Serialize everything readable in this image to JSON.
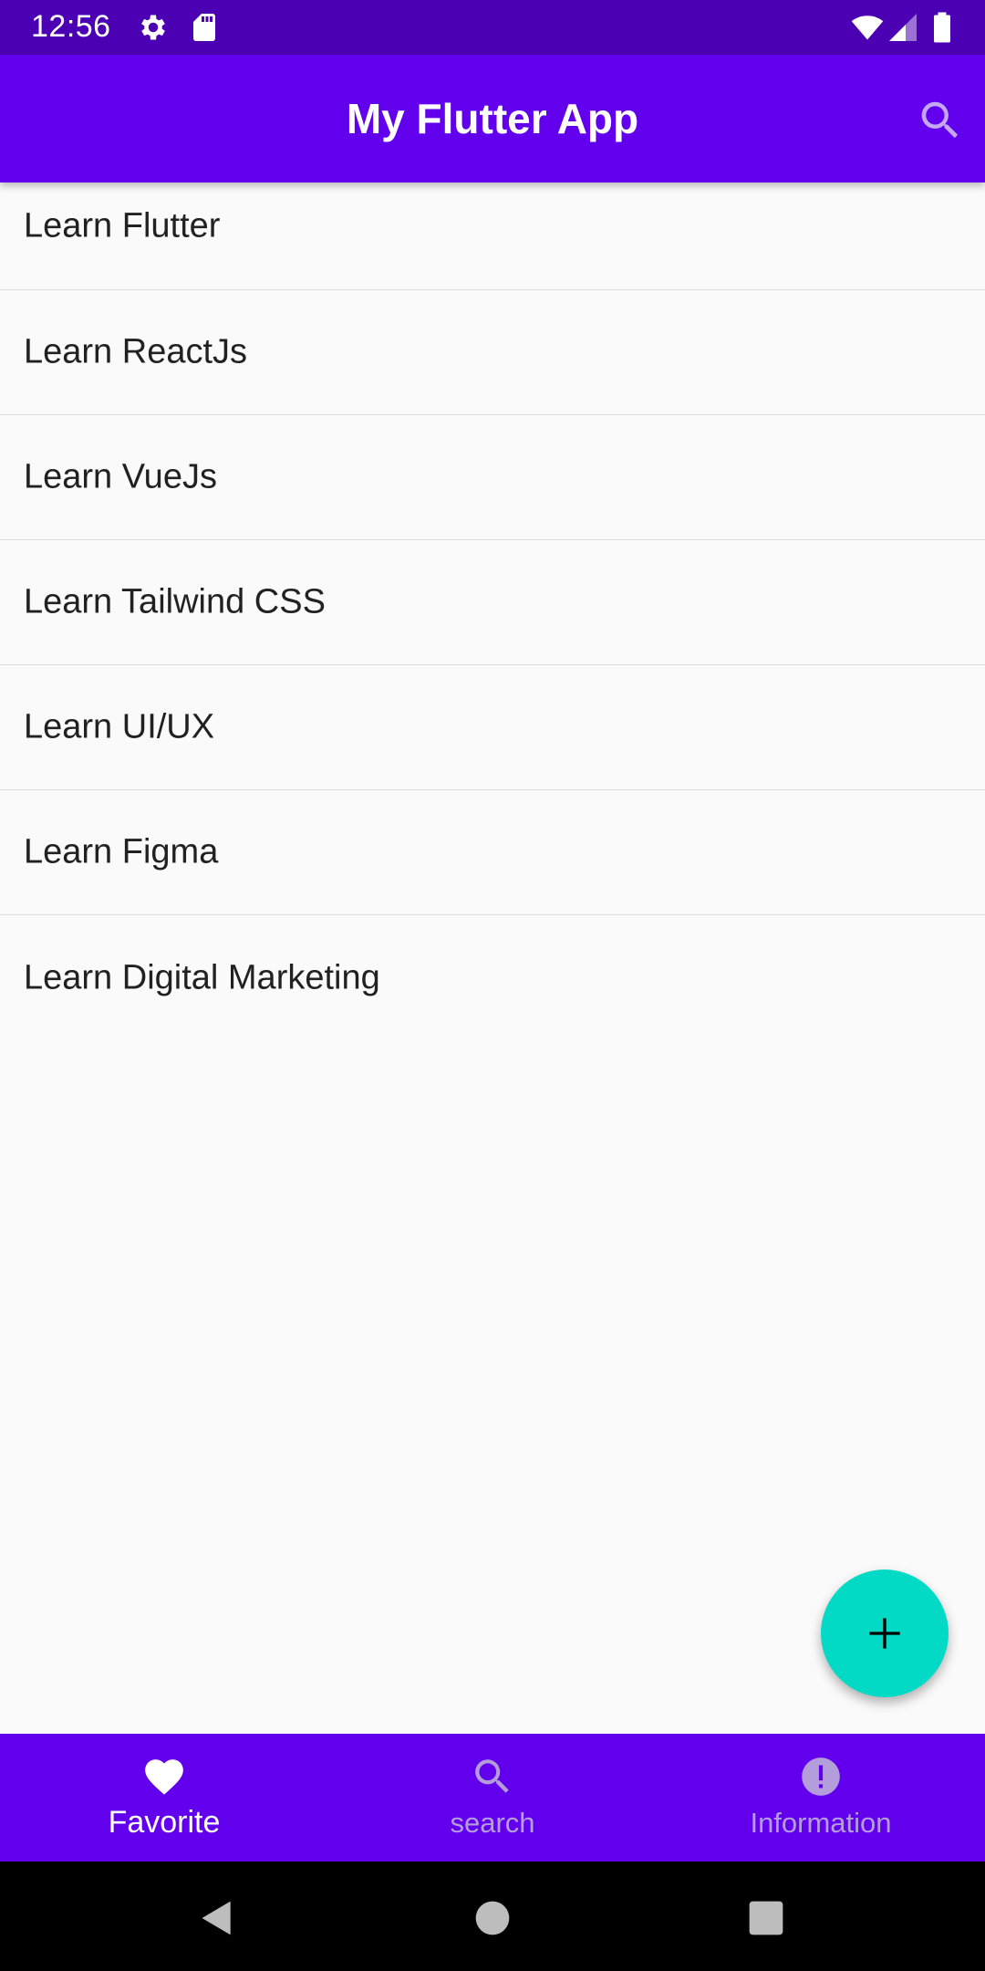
{
  "status_bar": {
    "time": "12:56",
    "icons": [
      "gear-icon",
      "sd-card-icon",
      "wifi-icon",
      "signal-icon",
      "battery-icon"
    ]
  },
  "app_bar": {
    "title": "My Flutter App",
    "action_icon": "search-icon"
  },
  "list": {
    "items": [
      {
        "label": "Learn Flutter"
      },
      {
        "label": "Learn ReactJs"
      },
      {
        "label": "Learn VueJs"
      },
      {
        "label": "Learn Tailwind CSS"
      },
      {
        "label": "Learn UI/UX"
      },
      {
        "label": "Learn Figma"
      },
      {
        "label": "Learn Digital Marketing"
      }
    ]
  },
  "fab": {
    "icon": "plus-icon"
  },
  "bottom_nav": {
    "items": [
      {
        "label": "Favorite",
        "icon": "heart-icon",
        "active": true
      },
      {
        "label": "search",
        "icon": "search-icon",
        "active": false
      },
      {
        "label": "Information",
        "icon": "info-icon",
        "active": false
      }
    ]
  },
  "system_nav": {
    "icons": [
      "back-icon",
      "home-icon",
      "recents-icon"
    ]
  },
  "colors": {
    "status_bar": "#4b00b3",
    "primary": "#6200ee",
    "accent": "#03dac6",
    "background": "#fafafa",
    "inactive_nav": "#b39ddb"
  }
}
